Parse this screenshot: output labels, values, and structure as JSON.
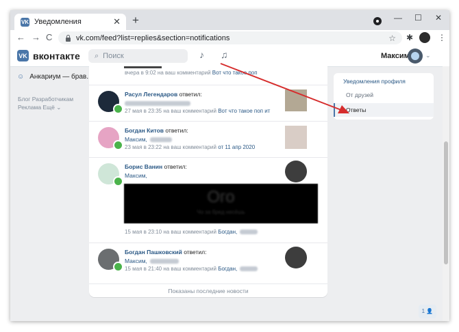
{
  "browser": {
    "tab_title": "Уведомления",
    "tab_favicon": "VK",
    "tab_close": "✕",
    "new_tab": "+",
    "url": "vk.com/feed?list=replies&section=notifications",
    "nav_back": "←",
    "nav_forward": "→",
    "nav_reload": "C",
    "star": "☆",
    "ext": "✱",
    "win_min": "—",
    "win_max": "☐",
    "win_close": "✕"
  },
  "header": {
    "logo": "VK",
    "brand": "вконтакте",
    "search_icon": "🔍",
    "search_placeholder": "Поиск",
    "bell_icon": "🔔",
    "music_icon": "♫",
    "user_name": "Максим",
    "chevron": "⌄"
  },
  "left_menu": {
    "item_icon": "👥",
    "item": "Анкариум — брав...",
    "links": "Блог  Разработчикам  Реклама  Ещё ⌄"
  },
  "feed": {
    "top_meta": "вчера в 9:02 на ваш комментарий",
    "top_link": "Вот что такое поп",
    "items": [
      {
        "name": "Расул Легендаров",
        "action": " ответил:",
        "subtext": "",
        "meta": "27 мая в 23:35 на ваш комментарий ",
        "link": "Вот что такое поп ит"
      },
      {
        "name": "Богдан Китов",
        "action": " ответил:",
        "subtext": "Максим,",
        "meta": "23 мая в 23:22 на ваш комментарий ",
        "link": "от 11 апр 2020"
      },
      {
        "name": "Борис Ванин",
        "action": " ответил:",
        "subtext": "Максим,",
        "image_text": "Ого",
        "image_caption": "Чо за бред несёшь",
        "meta": "15 мая в 23:10 на ваш комментарий ",
        "link": "Богдан,"
      },
      {
        "name": "Богдан Пашковский",
        "action": " ответил:",
        "subtext": "Максим,",
        "meta": "15 мая в 21:40 на ваш комментарий ",
        "link": "Богдан,"
      }
    ],
    "footer": "Показаны последние новости"
  },
  "right_menu": {
    "header": "Уведомления профиля",
    "item1": "От друзей",
    "item2": "Ответы"
  },
  "pager": "1 👤",
  "colors": {
    "accent": "#4a76a8",
    "link": "#2a5885",
    "online": "#4bb34b",
    "arrow": "#d62d2d"
  }
}
